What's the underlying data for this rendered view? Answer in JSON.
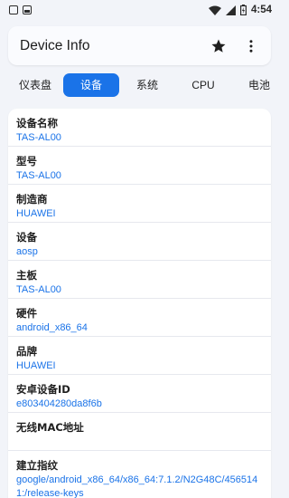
{
  "status_bar": {
    "time": "4:54"
  },
  "app_bar": {
    "title": "Device Info"
  },
  "tabs": [
    {
      "label": "仪表盘"
    },
    {
      "label": "设备",
      "active": true
    },
    {
      "label": "系统"
    },
    {
      "label": "CPU"
    },
    {
      "label": "电池"
    }
  ],
  "info": [
    {
      "label": "设备名称",
      "value": "TAS-AL00"
    },
    {
      "label": "型号",
      "value": "TAS-AL00"
    },
    {
      "label": "制造商",
      "value": "HUAWEI"
    },
    {
      "label": "设备",
      "value": "aosp"
    },
    {
      "label": "主板",
      "value": "TAS-AL00"
    },
    {
      "label": "硬件",
      "value": "android_x86_64"
    },
    {
      "label": "品牌",
      "value": "HUAWEI"
    },
    {
      "label": "安卓设备ID",
      "value": "e803404280da8f6b"
    },
    {
      "label": "无线MAC地址",
      "value": ""
    },
    {
      "label": "建立指纹",
      "value": "google/android_x86_64/x86_64:7.1.2/N2G48C/4565141:/release-keys"
    }
  ],
  "colors": {
    "accent": "#1a73e8",
    "background": "#f2f4f9"
  },
  "icons": {
    "favorite": "star-icon",
    "overflow": "more-vert-icon"
  }
}
